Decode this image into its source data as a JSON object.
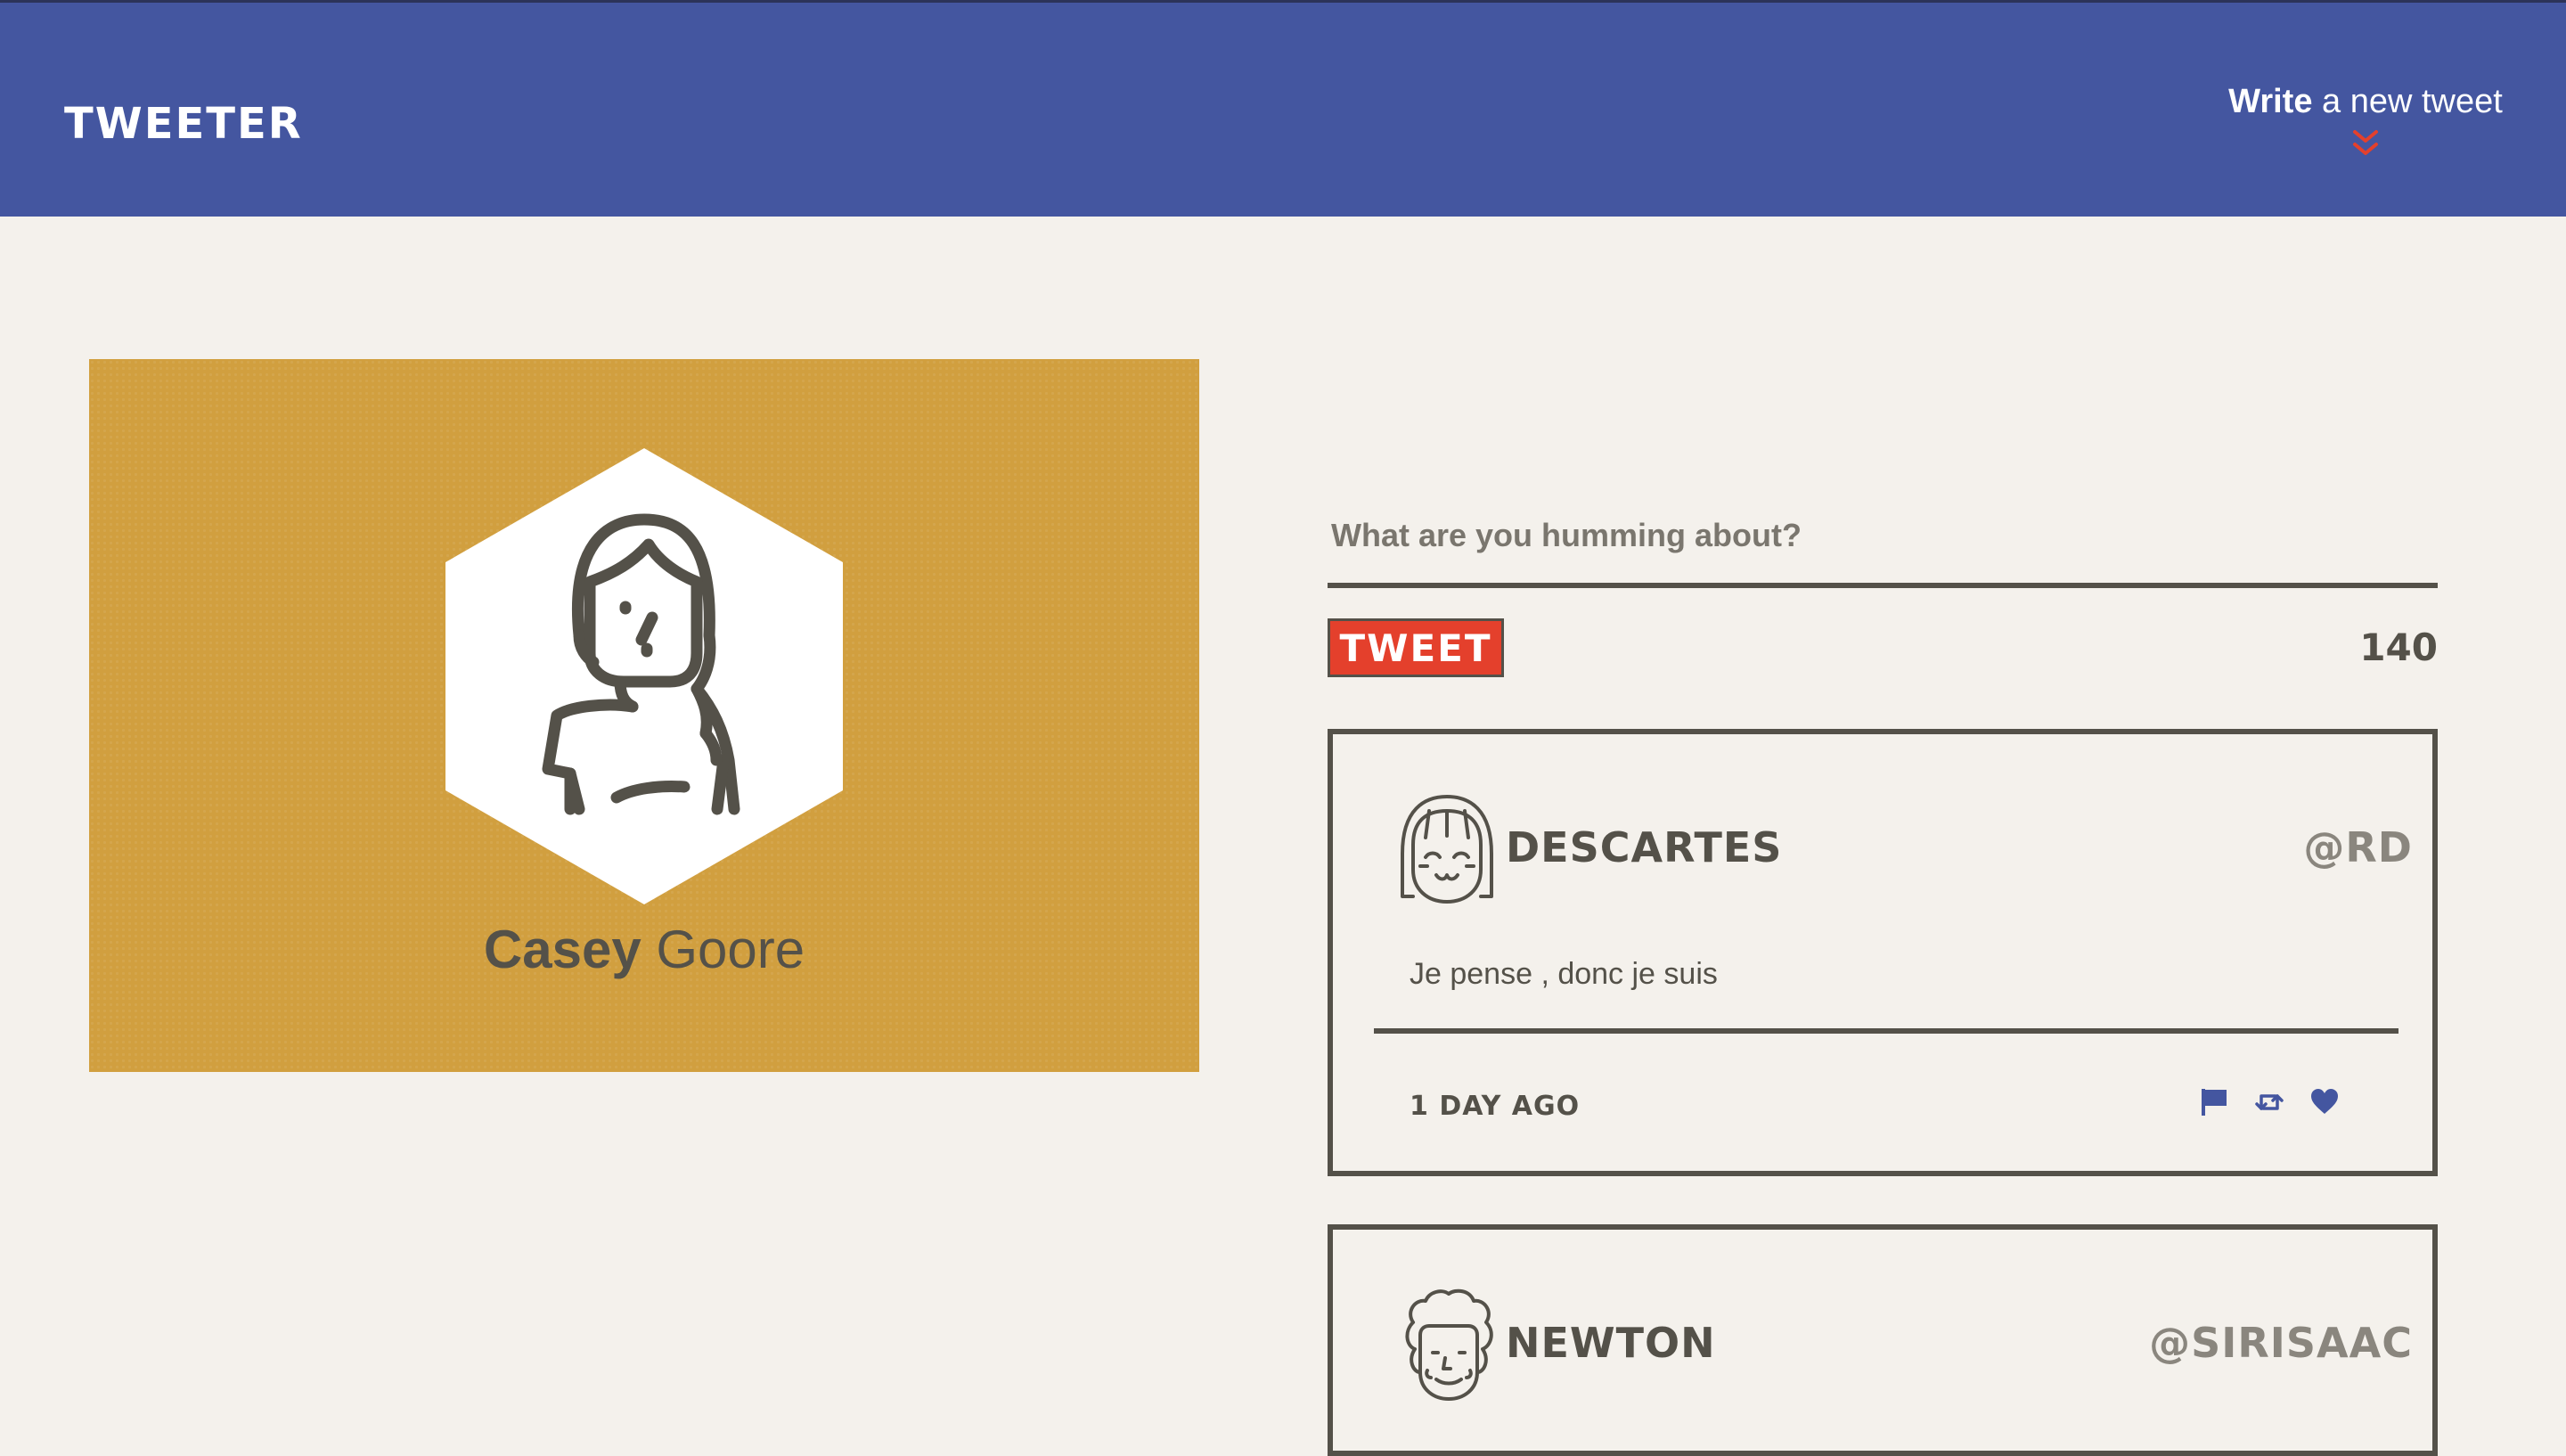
{
  "header": {
    "brand": "TWEETER",
    "compose_toggle": {
      "strong": "Write",
      "rest": " a new tweet"
    }
  },
  "profile": {
    "first_name": "Casey",
    "last_name": "Goore"
  },
  "composer": {
    "placeholder": "What are you humming about?",
    "button_label": "TWEET",
    "char_counter": "140"
  },
  "tweets": [
    {
      "author": "DESCARTES",
      "handle": "@RD",
      "text": "Je pense , donc je suis",
      "time": "1 DAY AGO"
    },
    {
      "author": "NEWTON",
      "handle": "@SIRISAAC"
    }
  ],
  "colors": {
    "nav_bg": "#4456a0",
    "page_bg": "#f4f1ec",
    "profile_bg": "#d19f3f",
    "accent_red": "#e4402c",
    "text_dark": "#545149",
    "icon_blue": "#4456a0"
  },
  "icons": [
    "chevron-double-down-icon",
    "flag-icon",
    "retweet-icon",
    "heart-icon"
  ]
}
